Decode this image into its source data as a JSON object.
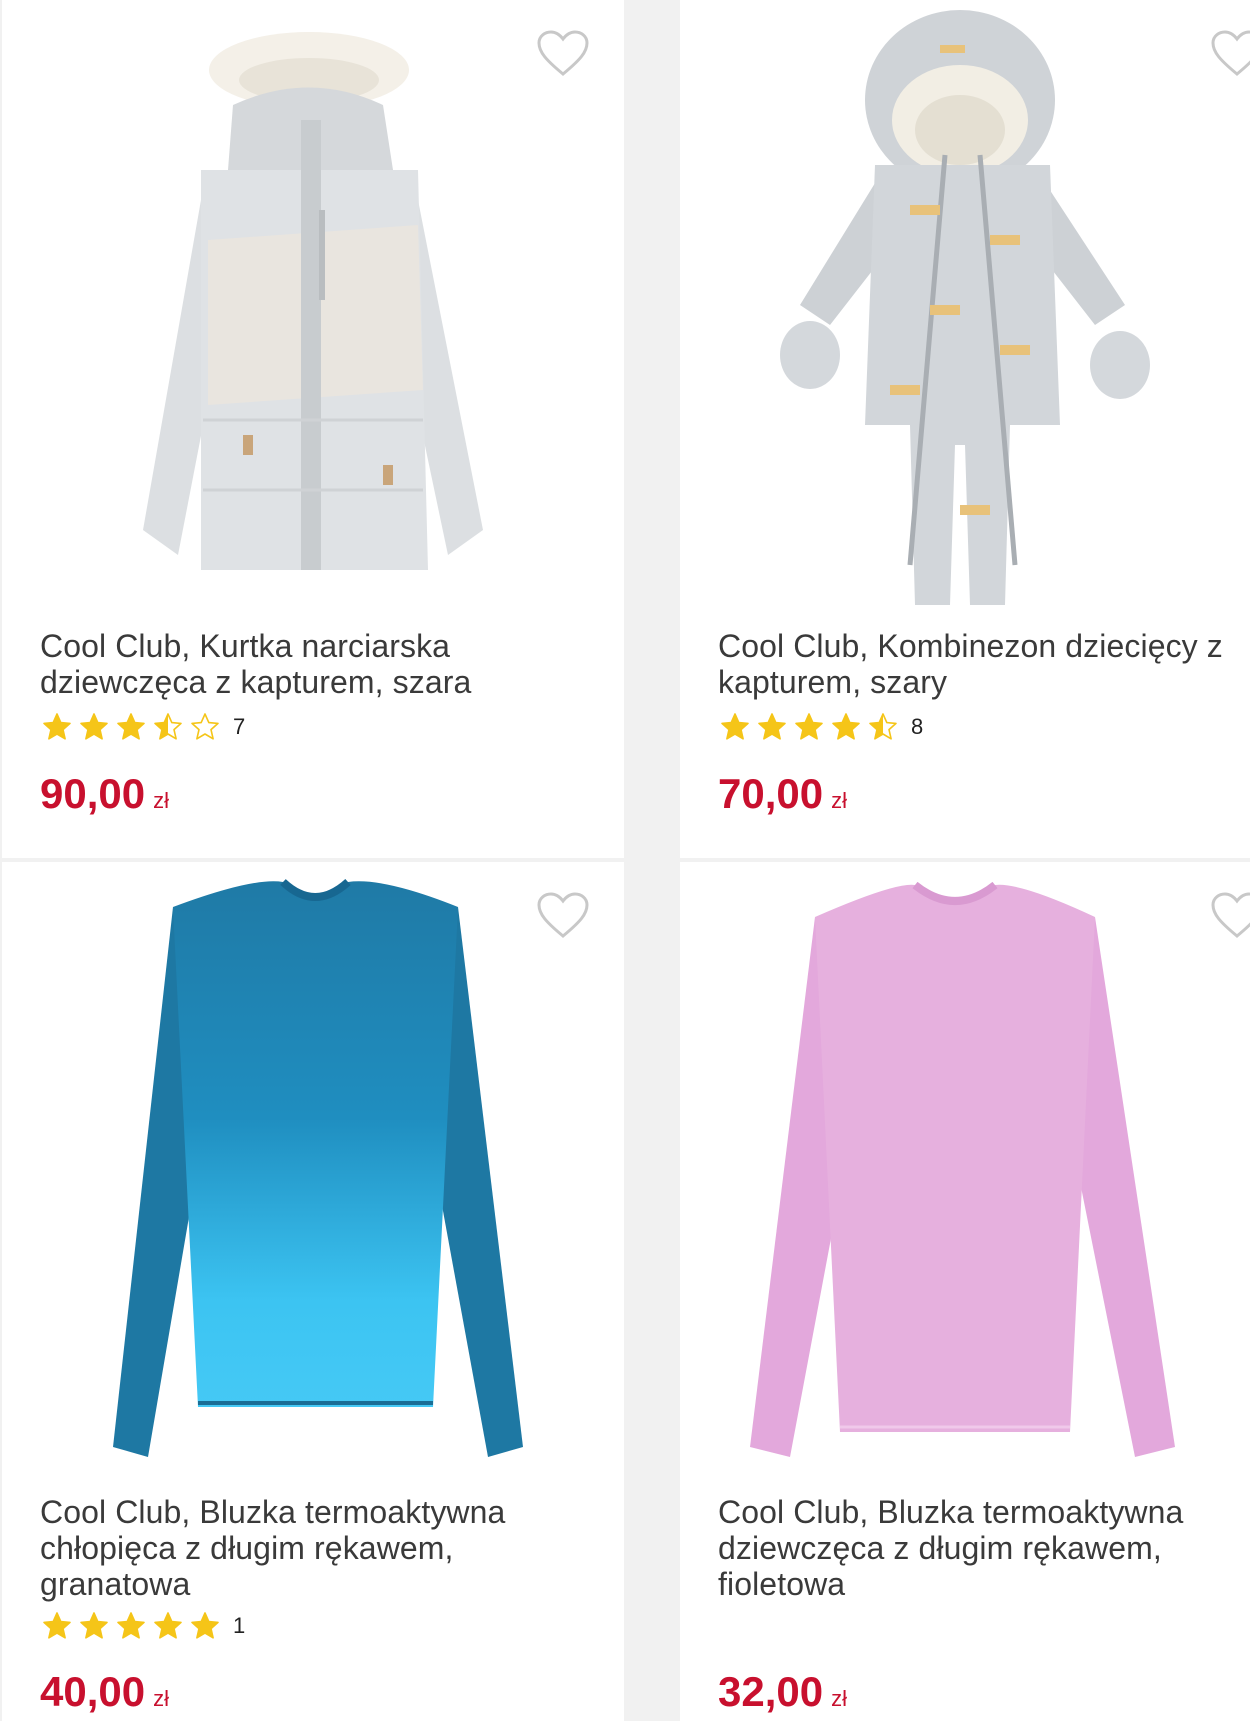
{
  "products": [
    {
      "title": "Cool Club, Kurtka narciarska dziewczęca z kapturem, szara",
      "rating_stars": 3.5,
      "rating_count": "7",
      "price": "90,00",
      "currency": "zł"
    },
    {
      "title": "Cool Club, Kombinezon dziecięcy z kapturem, szary",
      "rating_stars": 4.5,
      "rating_count": "8",
      "price": "70,00",
      "currency": "zł"
    },
    {
      "title": "Cool Club, Bluzka termoaktywna chłopięca z długim rękawem, granatowa",
      "rating_stars": 5,
      "rating_count": "1",
      "price": "40,00",
      "currency": "zł"
    },
    {
      "title": "Cool Club, Bluzka termoaktywna dziewczęca z długim rękawem, fioletowa",
      "price": "32,00",
      "currency": "zł"
    }
  ],
  "colors": {
    "price": "#c8102e",
    "star": "#f5c518",
    "heart_outline": "#c8c8c8"
  }
}
